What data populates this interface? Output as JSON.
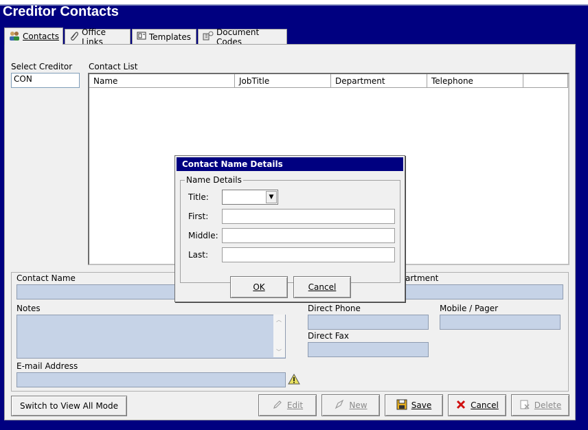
{
  "window": {
    "title": "Creditor Contacts"
  },
  "tabs": [
    {
      "icon": "people-icon",
      "label": "Contacts",
      "active": true
    },
    {
      "icon": "paperclip-icon",
      "label": "Office Links"
    },
    {
      "icon": "template-icon",
      "label": "Templates"
    },
    {
      "icon": "document-codes-icon",
      "label": "Document Codes"
    }
  ],
  "select_creditor": {
    "label": "Select Creditor",
    "value": "CON"
  },
  "contact_list": {
    "label": "Contact List",
    "columns": [
      "Name",
      "JobTitle",
      "Department",
      "Telephone"
    ]
  },
  "details": {
    "contact_name_label": "Contact Name",
    "department_label": "Department",
    "department_visible": "artment",
    "notes_label": "Notes",
    "direct_phone_label": "Direct Phone",
    "mobile_pager_label": "Mobile / Pager",
    "direct_fax_label": "Direct Fax",
    "email_label": "E-mail Address"
  },
  "buttons": {
    "switch_view": "Switch to View All Mode",
    "edit": "Edit",
    "new": "New",
    "save": "Save",
    "cancel": "Cancel",
    "delete": "Delete"
  },
  "dialog": {
    "title": "Contact Name Details",
    "group_label": "Name Details",
    "title_label": "Title:",
    "first_label": "First:",
    "middle_label": "Middle:",
    "last_label": "Last:",
    "title_value": "",
    "first_value": "",
    "middle_value": "",
    "last_value": "",
    "ok": "OK",
    "cancel": "Cancel"
  },
  "colors": {
    "window_bg": "#000080",
    "panel_bg": "#f0f0f0",
    "field_bg": "#c6d3e7"
  }
}
